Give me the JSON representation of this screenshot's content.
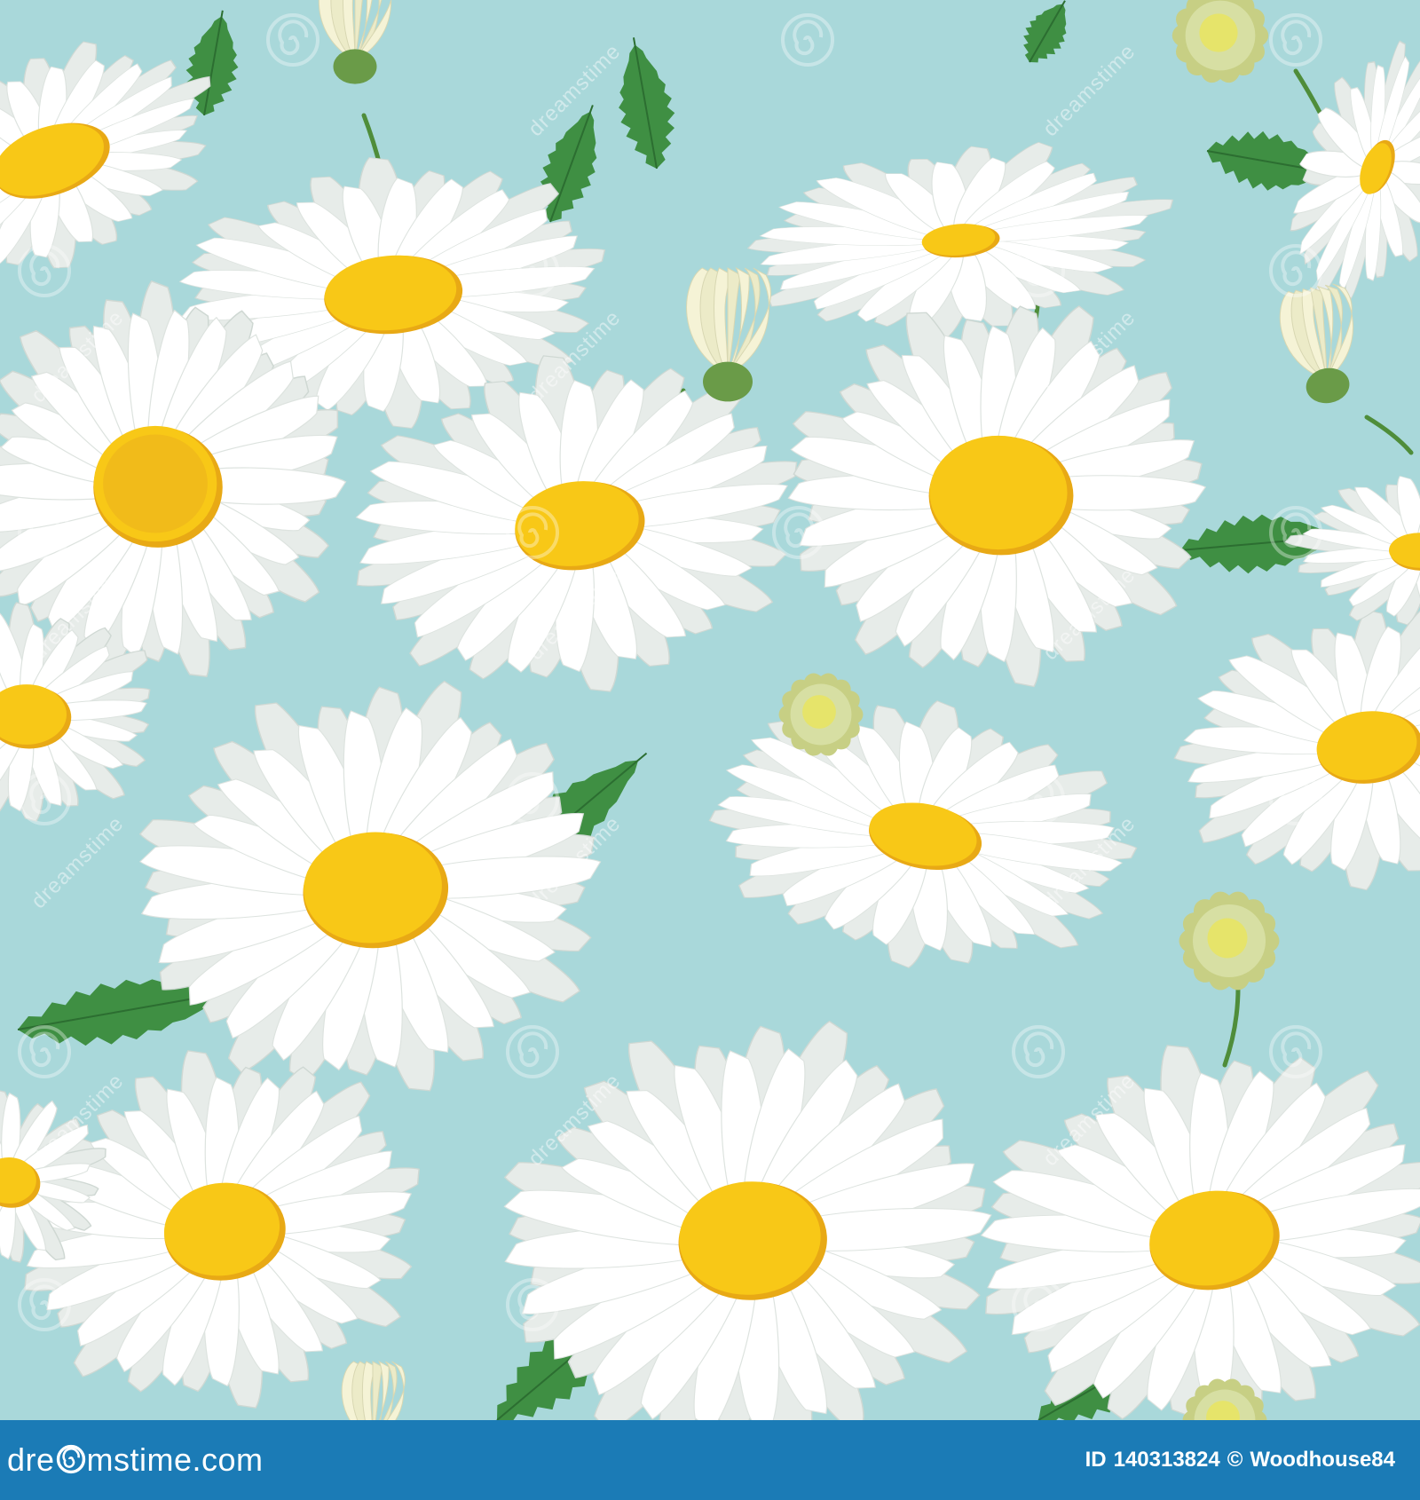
{
  "image": {
    "subject": "seamless pattern of white daisy flowers with yellow centers, buds and green leaves",
    "background_color": "#a9d8da",
    "petal_color": "#ffffff",
    "petal_shade_color": "#e7ece9",
    "center_color": "#f8c817",
    "center_shade_color": "#e8a915",
    "leaf_color": "#3f8f43",
    "stem_color": "#4f8d3a",
    "bud_color": "#d7dfa3"
  },
  "watermark": {
    "text": "dreamstime",
    "swirl_icon": "dreamstime-swirl-icon"
  },
  "footer": {
    "background_color": "#1b7bb6",
    "logo_text_before": "dreamstime",
    "logo_text_after": ".com",
    "id_label": "ID",
    "id_value": "140313824",
    "copyright_symbol": "©",
    "author": "Woodhouse84"
  }
}
